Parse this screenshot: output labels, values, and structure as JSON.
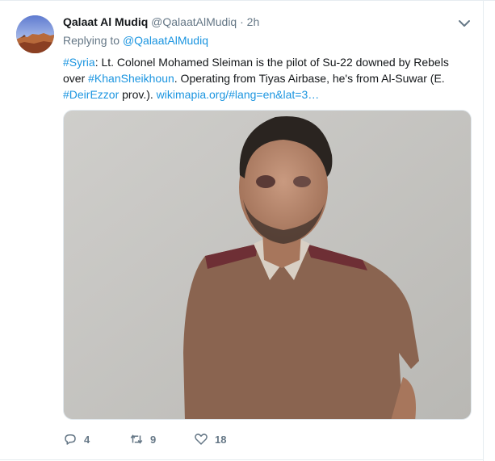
{
  "tweet": {
    "author_name": "Qalaat Al Mudiq",
    "author_handle": "@QalaatAlMudiq",
    "separator": "·",
    "time": "2h",
    "replying_label": "Replying to",
    "replying_to": "@QalaatAlMudiq",
    "text": {
      "hashtag_syria": "#Syria",
      "part1": ": Lt. Colonel Mohamed Sleiman is the pilot of Su-22 downed by Rebels over ",
      "hashtag_khansheikhoun": "#KhanSheikhoun",
      "part2": ". Operating from Tiyas Airbase, he's from Al-Suwar (E. ",
      "hashtag_deirezzor": "#DeirEzzor",
      "part3": " prov.). ",
      "link": "wikimapia.org/#lang=en&lat=3…"
    },
    "replies": "4",
    "retweets": "9",
    "likes": "18"
  },
  "icons": {
    "avatar": "avatar-image",
    "menu": "chevron-down-icon",
    "reply": "reply-icon",
    "retweet": "retweet-icon",
    "like": "heart-icon"
  },
  "colors": {
    "link": "#1b95e0",
    "secondary_text": "#657786",
    "primary_text": "#14171a"
  }
}
